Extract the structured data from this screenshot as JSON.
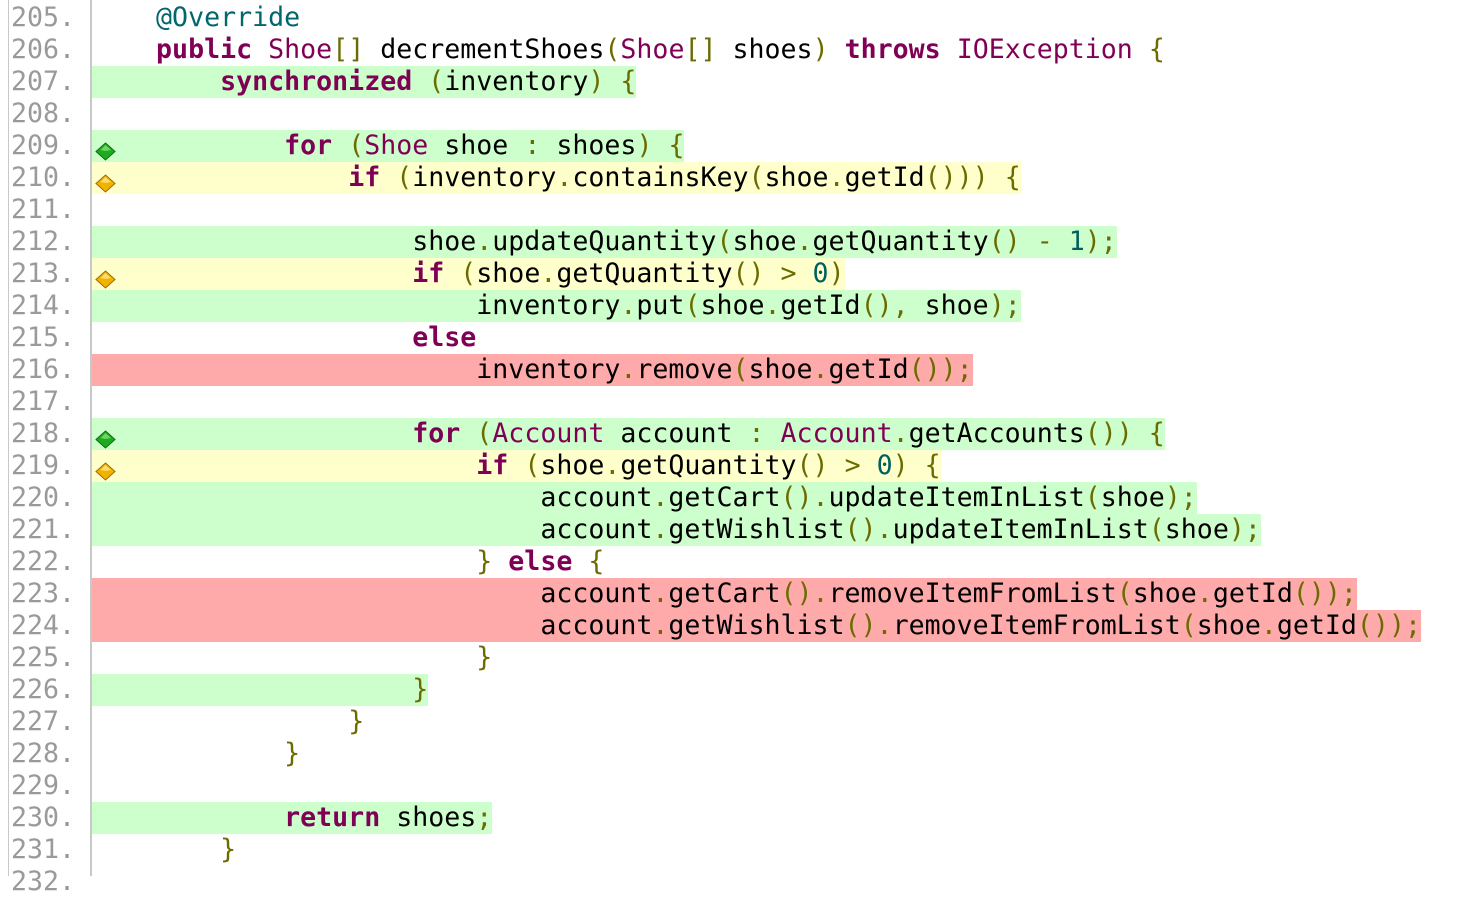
{
  "colors": {
    "covered": "#ccffcc",
    "partial": "#ffffcc",
    "missed": "#ffaaaa",
    "keyword": "#7f0055",
    "annotation": "#00676c",
    "line_number": "#9a9a9a",
    "punctuation": "#6b6b00",
    "green_diamond": "#1faa1f",
    "yellow_diamond": "#f0b400"
  },
  "code_lines": [
    {
      "num": "205.",
      "coverage": "none",
      "indent": 4,
      "marker": null,
      "tokens": [
        [
          "an",
          "@Override"
        ]
      ]
    },
    {
      "num": "206.",
      "coverage": "none",
      "indent": 4,
      "marker": null,
      "tokens": [
        [
          "kw",
          "public"
        ],
        [
          "tx",
          " "
        ],
        [
          "ty",
          "Shoe"
        ],
        [
          "pn",
          "[]"
        ],
        [
          "tx",
          " decrementShoes"
        ],
        [
          "pn",
          "("
        ],
        [
          "ty",
          "Shoe"
        ],
        [
          "pn",
          "[]"
        ],
        [
          "tx",
          " shoes"
        ],
        [
          "pn",
          ")"
        ],
        [
          "tx",
          " "
        ],
        [
          "kw",
          "throws"
        ],
        [
          "tx",
          " "
        ],
        [
          "ty",
          "IOException"
        ],
        [
          "tx",
          " "
        ],
        [
          "pn",
          "{"
        ]
      ]
    },
    {
      "num": "207.",
      "coverage": "covered",
      "indent": 8,
      "marker": null,
      "tokens": [
        [
          "kw",
          "synchronized"
        ],
        [
          "tx",
          " "
        ],
        [
          "pn",
          "("
        ],
        [
          "tx",
          "inventory"
        ],
        [
          "pn",
          ")"
        ],
        [
          "tx",
          " "
        ],
        [
          "pn",
          "{"
        ]
      ]
    },
    {
      "num": "208.",
      "coverage": "none",
      "indent": 0,
      "marker": null,
      "tokens": []
    },
    {
      "num": "209.",
      "coverage": "covered",
      "indent": 12,
      "marker": "green-diamond",
      "tokens": [
        [
          "kw",
          "for"
        ],
        [
          "tx",
          " "
        ],
        [
          "pn",
          "("
        ],
        [
          "ty",
          "Shoe"
        ],
        [
          "tx",
          " shoe "
        ],
        [
          "op",
          ":"
        ],
        [
          "tx",
          " shoes"
        ],
        [
          "pn",
          ")"
        ],
        [
          "tx",
          " "
        ],
        [
          "pn",
          "{"
        ]
      ]
    },
    {
      "num": "210.",
      "coverage": "partial",
      "indent": 16,
      "marker": "yellow-diamond",
      "tokens": [
        [
          "kw",
          "if"
        ],
        [
          "tx",
          " "
        ],
        [
          "pn",
          "("
        ],
        [
          "tx",
          "inventory"
        ],
        [
          "pn",
          "."
        ],
        [
          "tx",
          "containsKey"
        ],
        [
          "pn",
          "("
        ],
        [
          "tx",
          "shoe"
        ],
        [
          "pn",
          "."
        ],
        [
          "tx",
          "getId"
        ],
        [
          "pn",
          "()))"
        ],
        [
          "tx",
          " "
        ],
        [
          "pn",
          "{"
        ]
      ]
    },
    {
      "num": "211.",
      "coverage": "none",
      "indent": 0,
      "marker": null,
      "tokens": []
    },
    {
      "num": "212.",
      "coverage": "covered",
      "indent": 20,
      "marker": null,
      "tokens": [
        [
          "tx",
          "shoe"
        ],
        [
          "pn",
          "."
        ],
        [
          "tx",
          "updateQuantity"
        ],
        [
          "pn",
          "("
        ],
        [
          "tx",
          "shoe"
        ],
        [
          "pn",
          "."
        ],
        [
          "tx",
          "getQuantity"
        ],
        [
          "pn",
          "()"
        ],
        [
          "tx",
          " "
        ],
        [
          "op",
          "-"
        ],
        [
          "tx",
          " "
        ],
        [
          "nm",
          "1"
        ],
        [
          "pn",
          ");"
        ]
      ]
    },
    {
      "num": "213.",
      "coverage": "partial",
      "indent": 20,
      "marker": "yellow-diamond",
      "tokens": [
        [
          "kw",
          "if"
        ],
        [
          "tx",
          " "
        ],
        [
          "pn",
          "("
        ],
        [
          "tx",
          "shoe"
        ],
        [
          "pn",
          "."
        ],
        [
          "tx",
          "getQuantity"
        ],
        [
          "pn",
          "()"
        ],
        [
          "tx",
          " "
        ],
        [
          "op",
          ">"
        ],
        [
          "tx",
          " "
        ],
        [
          "nm",
          "0"
        ],
        [
          "pn",
          ")"
        ]
      ]
    },
    {
      "num": "214.",
      "coverage": "covered",
      "indent": 24,
      "marker": null,
      "tokens": [
        [
          "tx",
          "inventory"
        ],
        [
          "pn",
          "."
        ],
        [
          "tx",
          "put"
        ],
        [
          "pn",
          "("
        ],
        [
          "tx",
          "shoe"
        ],
        [
          "pn",
          "."
        ],
        [
          "tx",
          "getId"
        ],
        [
          "pn",
          "(),"
        ],
        [
          "tx",
          " shoe"
        ],
        [
          "pn",
          ");"
        ]
      ]
    },
    {
      "num": "215.",
      "coverage": "none",
      "indent": 20,
      "marker": null,
      "tokens": [
        [
          "kw",
          "else"
        ]
      ]
    },
    {
      "num": "216.",
      "coverage": "missed",
      "indent": 24,
      "marker": null,
      "tokens": [
        [
          "tx",
          "inventory"
        ],
        [
          "pn",
          "."
        ],
        [
          "tx",
          "remove"
        ],
        [
          "pn",
          "("
        ],
        [
          "tx",
          "shoe"
        ],
        [
          "pn",
          "."
        ],
        [
          "tx",
          "getId"
        ],
        [
          "pn",
          "());"
        ]
      ]
    },
    {
      "num": "217.",
      "coverage": "none",
      "indent": 0,
      "marker": null,
      "tokens": []
    },
    {
      "num": "218.",
      "coverage": "covered",
      "indent": 20,
      "marker": "green-diamond",
      "tokens": [
        [
          "kw",
          "for"
        ],
        [
          "tx",
          " "
        ],
        [
          "pn",
          "("
        ],
        [
          "ty",
          "Account"
        ],
        [
          "tx",
          " account "
        ],
        [
          "op",
          ":"
        ],
        [
          "tx",
          " "
        ],
        [
          "ty",
          "Account"
        ],
        [
          "pn",
          "."
        ],
        [
          "tx",
          "getAccounts"
        ],
        [
          "pn",
          "())"
        ],
        [
          "tx",
          " "
        ],
        [
          "pn",
          "{"
        ]
      ]
    },
    {
      "num": "219.",
      "coverage": "partial",
      "indent": 24,
      "marker": "yellow-diamond",
      "tokens": [
        [
          "kw",
          "if"
        ],
        [
          "tx",
          " "
        ],
        [
          "pn",
          "("
        ],
        [
          "tx",
          "shoe"
        ],
        [
          "pn",
          "."
        ],
        [
          "tx",
          "getQuantity"
        ],
        [
          "pn",
          "()"
        ],
        [
          "tx",
          " "
        ],
        [
          "op",
          ">"
        ],
        [
          "tx",
          " "
        ],
        [
          "nm",
          "0"
        ],
        [
          "pn",
          ")"
        ],
        [
          "tx",
          " "
        ],
        [
          "pn",
          "{"
        ]
      ]
    },
    {
      "num": "220.",
      "coverage": "covered",
      "indent": 28,
      "marker": null,
      "tokens": [
        [
          "tx",
          "account"
        ],
        [
          "pn",
          "."
        ],
        [
          "tx",
          "getCart"
        ],
        [
          "pn",
          "()."
        ],
        [
          "tx",
          "updateItemInList"
        ],
        [
          "pn",
          "("
        ],
        [
          "tx",
          "shoe"
        ],
        [
          "pn",
          ");"
        ]
      ]
    },
    {
      "num": "221.",
      "coverage": "covered",
      "indent": 28,
      "marker": null,
      "tokens": [
        [
          "tx",
          "account"
        ],
        [
          "pn",
          "."
        ],
        [
          "tx",
          "getWishlist"
        ],
        [
          "pn",
          "()."
        ],
        [
          "tx",
          "updateItemInList"
        ],
        [
          "pn",
          "("
        ],
        [
          "tx",
          "shoe"
        ],
        [
          "pn",
          ");"
        ]
      ]
    },
    {
      "num": "222.",
      "coverage": "none",
      "indent": 24,
      "marker": null,
      "tokens": [
        [
          "pn",
          "}"
        ],
        [
          "tx",
          " "
        ],
        [
          "kw",
          "else"
        ],
        [
          "tx",
          " "
        ],
        [
          "pn",
          "{"
        ]
      ]
    },
    {
      "num": "223.",
      "coverage": "missed",
      "indent": 28,
      "marker": null,
      "tokens": [
        [
          "tx",
          "account"
        ],
        [
          "pn",
          "."
        ],
        [
          "tx",
          "getCart"
        ],
        [
          "pn",
          "()."
        ],
        [
          "tx",
          "removeItemFromList"
        ],
        [
          "pn",
          "("
        ],
        [
          "tx",
          "shoe"
        ],
        [
          "pn",
          "."
        ],
        [
          "tx",
          "getId"
        ],
        [
          "pn",
          "());"
        ]
      ]
    },
    {
      "num": "224.",
      "coverage": "missed",
      "indent": 28,
      "marker": null,
      "tokens": [
        [
          "tx",
          "account"
        ],
        [
          "pn",
          "."
        ],
        [
          "tx",
          "getWishlist"
        ],
        [
          "pn",
          "()."
        ],
        [
          "tx",
          "removeItemFromList"
        ],
        [
          "pn",
          "("
        ],
        [
          "tx",
          "shoe"
        ],
        [
          "pn",
          "."
        ],
        [
          "tx",
          "getId"
        ],
        [
          "pn",
          "());"
        ]
      ]
    },
    {
      "num": "225.",
      "coverage": "none",
      "indent": 24,
      "marker": null,
      "tokens": [
        [
          "pn",
          "}"
        ]
      ]
    },
    {
      "num": "226.",
      "coverage": "covered",
      "indent": 20,
      "marker": null,
      "tokens": [
        [
          "pn",
          "}"
        ]
      ]
    },
    {
      "num": "227.",
      "coverage": "none",
      "indent": 16,
      "marker": null,
      "tokens": [
        [
          "pn",
          "}"
        ]
      ]
    },
    {
      "num": "228.",
      "coverage": "none",
      "indent": 12,
      "marker": null,
      "tokens": [
        [
          "pn",
          "}"
        ]
      ]
    },
    {
      "num": "229.",
      "coverage": "none",
      "indent": 0,
      "marker": null,
      "tokens": []
    },
    {
      "num": "230.",
      "coverage": "covered",
      "indent": 12,
      "marker": null,
      "tokens": [
        [
          "kw",
          "return"
        ],
        [
          "tx",
          " shoes"
        ],
        [
          "pn",
          ";"
        ]
      ]
    },
    {
      "num": "231.",
      "coverage": "none",
      "indent": 8,
      "marker": null,
      "tokens": [
        [
          "pn",
          "}"
        ]
      ]
    },
    {
      "num": "232.",
      "coverage": "none",
      "indent": 0,
      "marker": null,
      "tokens": []
    }
  ]
}
